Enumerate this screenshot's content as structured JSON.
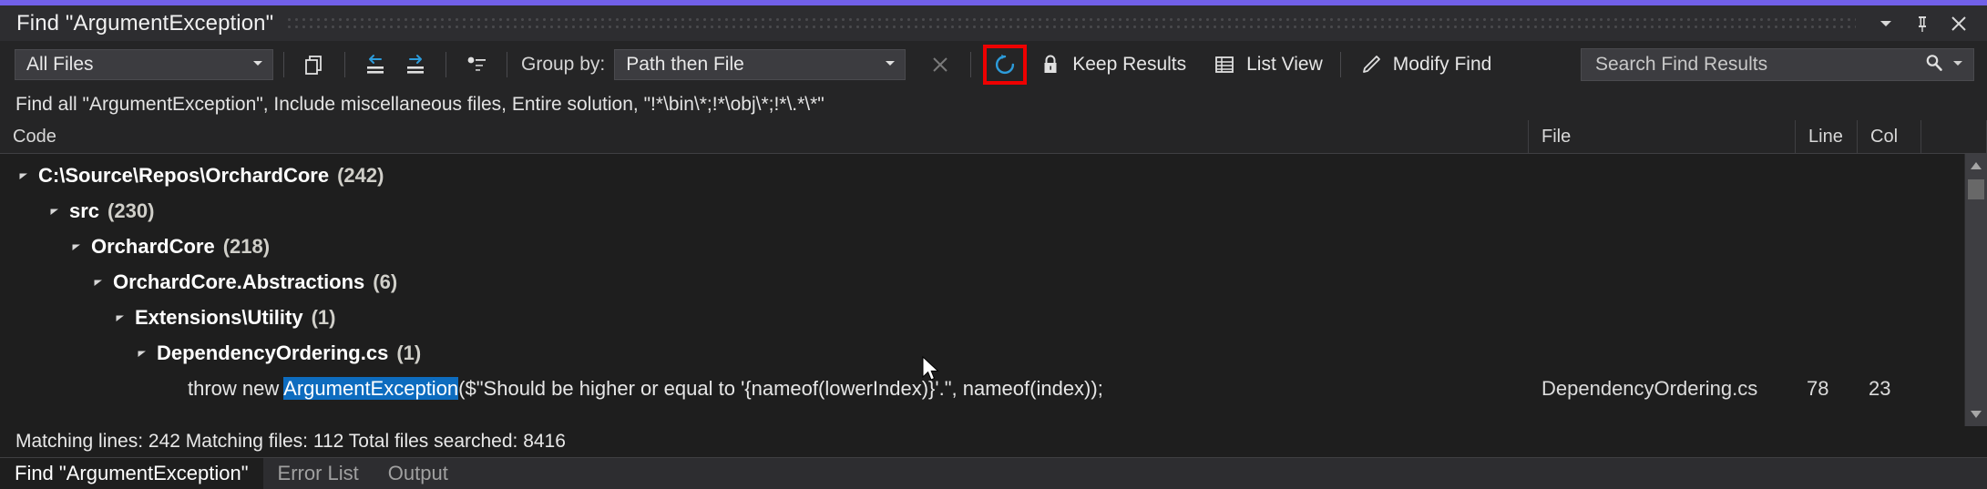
{
  "window": {
    "title": "Find \"ArgumentException\"",
    "accent_color": "#7160e8",
    "controls": [
      {
        "name": "window-dropdown",
        "icon": "chevron-down-icon"
      },
      {
        "name": "window-pin",
        "icon": "pin-icon"
      },
      {
        "name": "window-close",
        "icon": "close-icon"
      }
    ]
  },
  "toolbar": {
    "files_filter": {
      "value": "All Files",
      "icon": "chevron-down-icon"
    },
    "copy_button": {
      "label": "",
      "icon": "copy-icon"
    },
    "collapse_button": {
      "label": "",
      "icon": "arrow-left-lines-icon"
    },
    "expand_button": {
      "label": "",
      "icon": "arrow-right-lines-icon"
    },
    "outline_button": {
      "label": "",
      "icon": "list-outline-icon"
    },
    "group_by_label": "Group by:",
    "group_by": {
      "value": "Path then File",
      "icon": "chevron-down-icon"
    },
    "stop_button": {
      "label": "",
      "icon": "close-icon"
    },
    "refresh_button": {
      "label": "",
      "icon": "refresh-icon",
      "highlight_color": "#ee0000",
      "icon_color": "#2d9cdb"
    },
    "keep_results": {
      "label": "Keep Results",
      "icon": "lock-icon"
    },
    "list_view": {
      "label": "List View",
      "icon": "grid-icon"
    },
    "modify_find": {
      "label": "Modify Find",
      "icon": "pencil-icon"
    },
    "search": {
      "value": "",
      "placeholder": "Search Find Results",
      "icon": "magnifier-icon",
      "dropdown_icon": "chevron-down-icon"
    }
  },
  "query_summary": "Find all \"ArgumentException\", Include miscellaneous files, Entire solution, \"!*\\bin\\*;!*\\obj\\*;!*\\.*\\*\"",
  "columns": {
    "code": "Code",
    "file": "File",
    "line": "Line",
    "col": "Col"
  },
  "tree": {
    "nodes": [
      {
        "indent": 0,
        "name": "C:\\Source\\Repos\\OrchardCore",
        "count": "(242)",
        "expanded": true
      },
      {
        "indent": 1,
        "name": "src",
        "count": "(230)",
        "expanded": true
      },
      {
        "indent": 2,
        "name": "OrchardCore",
        "count": "(218)",
        "expanded": true
      },
      {
        "indent": 3,
        "name": "OrchardCore.Abstractions",
        "count": "(6)",
        "expanded": true
      },
      {
        "indent": 4,
        "name": "Extensions\\Utility",
        "count": "(1)",
        "expanded": true
      },
      {
        "indent": 5,
        "name": "DependencyOrdering.cs",
        "count": "(1)",
        "expanded": true
      }
    ],
    "match": {
      "indent": 6,
      "prefix": "throw new ",
      "highlight": "ArgumentException",
      "suffix": "($\"Should be higher or equal to '{nameof(lowerIndex)}'.\", nameof(index));",
      "highlight_color": "#0d6cbf",
      "file": "DependencyOrdering.cs",
      "line": "78",
      "col": "23"
    }
  },
  "status": "Matching lines: 242 Matching files: 112 Total files searched: 8416",
  "tabs": [
    {
      "label": "Find \"ArgumentException\"",
      "active": true
    },
    {
      "label": "Error List",
      "active": false
    },
    {
      "label": "Output",
      "active": false
    }
  ]
}
